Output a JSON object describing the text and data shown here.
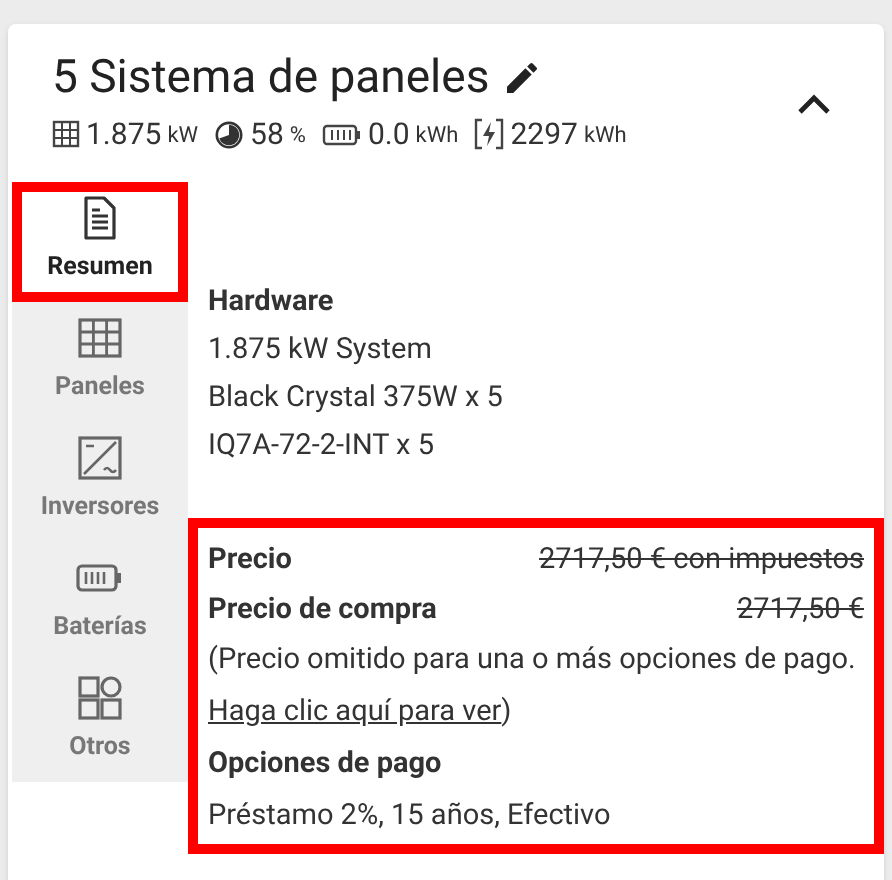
{
  "header": {
    "title": "5 Sistema de paneles",
    "stats": [
      {
        "kind": "panels",
        "value": "1.875",
        "unit": "kW"
      },
      {
        "kind": "offset",
        "value": "58",
        "unit": "%"
      },
      {
        "kind": "battery",
        "value": "0.0",
        "unit": "kWh"
      },
      {
        "kind": "production",
        "value": "2297",
        "unit": "kWh"
      }
    ],
    "expanded": true
  },
  "tabs": [
    {
      "label": "Resumen",
      "kind": "summary",
      "selected": true,
      "highlighted": true
    },
    {
      "label": "Paneles",
      "kind": "panels",
      "selected": false,
      "highlighted": false
    },
    {
      "label": "Inversores",
      "kind": "inverters",
      "selected": false,
      "highlighted": false
    },
    {
      "label": "Baterías",
      "kind": "batteries",
      "selected": false,
      "highlighted": false
    },
    {
      "label": "Otros",
      "kind": "others",
      "selected": false,
      "highlighted": false
    }
  ],
  "hardware": {
    "heading": "Hardware",
    "lines": [
      "1.875 kW System",
      "Black Crystal 375W x 5",
      "IQ7A-72-2-INT x 5"
    ]
  },
  "pricing": {
    "highlighted": true,
    "rows": [
      {
        "label": "Precio",
        "value": "2717,50 € con impuestos",
        "struck": true
      },
      {
        "label": "Precio de compra",
        "value": "2717,50 €",
        "struck": true
      }
    ],
    "note": "(Precio omitido para una o más opciones de pago. ",
    "link": "Haga clic aquí para ver",
    "note_end": ")",
    "options_heading": "Opciones de pago",
    "options": "Préstamo 2%, 15 años, Efectivo"
  }
}
